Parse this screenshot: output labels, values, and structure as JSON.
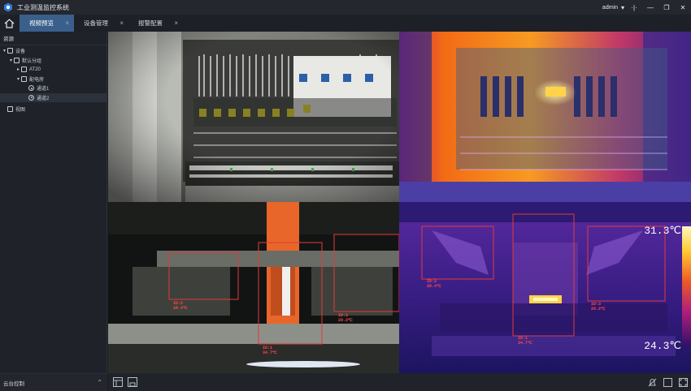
{
  "app": {
    "title": "工业测温监控系统",
    "user": "admin"
  },
  "tabs": [
    {
      "label": "视频预览",
      "active": true
    },
    {
      "label": "设备管理",
      "active": false
    },
    {
      "label": "报警配置",
      "active": false
    }
  ],
  "sidebar": {
    "header": "资源",
    "tree": [
      {
        "label": "设备",
        "level": 0
      },
      {
        "label": "默认分组",
        "level": 1
      },
      {
        "label": "AT20",
        "level": 2
      },
      {
        "label": "配电房",
        "level": 2
      },
      {
        "label": "通道1",
        "level": 3
      },
      {
        "label": "通道2",
        "level": 3,
        "selected": true
      },
      {
        "label": "视图",
        "level": 0
      }
    ],
    "ptz_label": "云台控制"
  },
  "thermal_bottom_right": {
    "temp_max": "31.3℃",
    "temp_min": "24.3℃",
    "tags": [
      {
        "id": "ID:2",
        "temp": "28.4℃"
      },
      {
        "id": "ID:1",
        "temp": "34.7℃"
      },
      {
        "id": "ID:3",
        "temp": "29.2℃"
      }
    ]
  },
  "visible_bottom_left": {
    "tags": [
      {
        "id": "ID:2",
        "temp": "28.4℃"
      },
      {
        "id": "ID:1",
        "temp": "34.7℃"
      },
      {
        "id": "ID:3",
        "temp": "29.2℃"
      }
    ]
  },
  "colors": {
    "accent_tab": "#3a5f8c",
    "alarm_box": "#e23a3a"
  }
}
